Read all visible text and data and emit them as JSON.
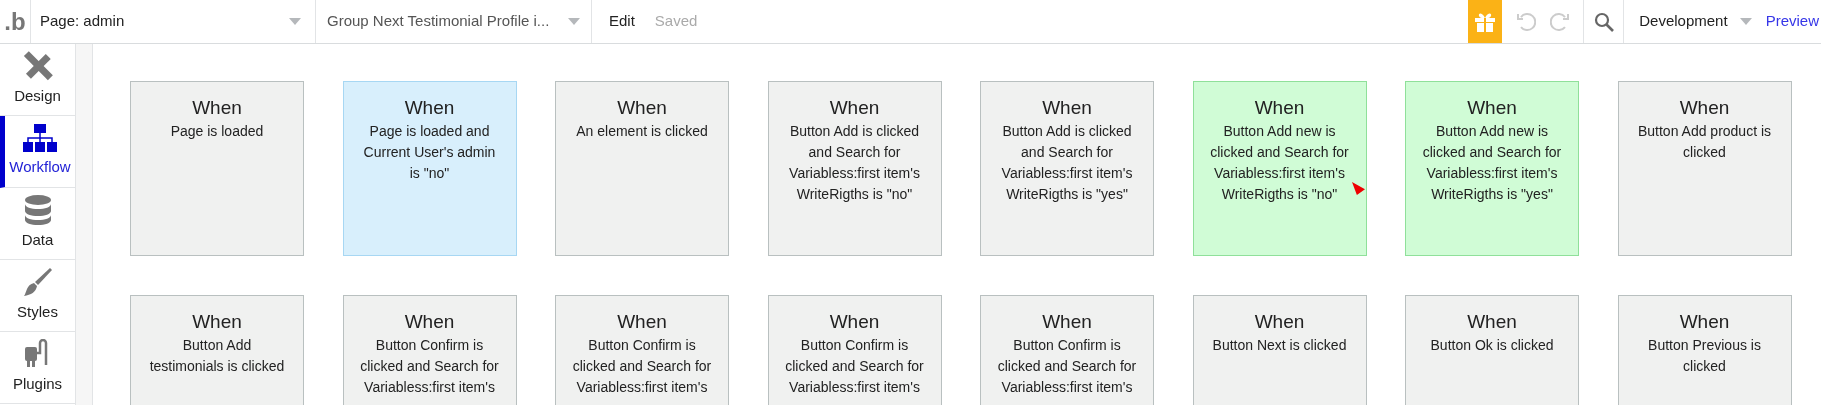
{
  "topbar": {
    "logo": ".b",
    "page_dropdown": "Page: admin",
    "element_dropdown": "Group Next Testimonial Profile i...",
    "edit": "Edit",
    "save_status": "Saved",
    "undo_disabled": true,
    "redo_disabled": true,
    "environment": "Development",
    "preview": "Preview"
  },
  "sidebar": {
    "items": [
      {
        "label": "Design",
        "kind": "design",
        "selected": false
      },
      {
        "label": "Workflow",
        "kind": "workflow",
        "selected": true
      },
      {
        "label": "Data",
        "kind": "data",
        "selected": false
      },
      {
        "label": "Styles",
        "kind": "styles",
        "selected": false
      },
      {
        "label": "Plugins",
        "kind": "plugins",
        "selected": false
      }
    ]
  },
  "events": [
    {
      "title": "When",
      "text": "Page is loaded",
      "color": "#f0f1f0",
      "flagged": false
    },
    {
      "title": "When",
      "text": "Page is loaded and Current User's admin is \"no\"",
      "color": "#d8effc",
      "flagged": false
    },
    {
      "title": "When",
      "text": "An element is clicked",
      "color": "#f0f1f0",
      "flagged": false
    },
    {
      "title": "When",
      "text": "Button Add is clicked and Search for Variabless:first item's WriteRigths is \"no\"",
      "color": "#f0f1f0",
      "flagged": false
    },
    {
      "title": "When",
      "text": "Button Add is clicked and Search for Variabless:first item's WriteRigths is \"yes\"",
      "color": "#f0f1f0",
      "flagged": false
    },
    {
      "title": "When",
      "text": "Button Add new is clicked and Search for Variabless:first item's WriteRigths is \"no\"",
      "color": "#d0fcd6",
      "flagged": true
    },
    {
      "title": "When",
      "text": "Button Add new is clicked and Search for Variabless:first item's WriteRigths is \"yes\"",
      "color": "#d0fcd6",
      "flagged": false
    },
    {
      "title": "When",
      "text": "Button Add product is clicked",
      "color": "#f0f1f0",
      "flagged": false
    },
    {
      "title": "When",
      "text": "Button Add testimonials is clicked",
      "color": "#f0f1f0",
      "flagged": false
    },
    {
      "title": "When",
      "text": "Button Confirm is clicked and Search for Variabless:first item's",
      "color": "#f0f1f0",
      "flagged": false
    },
    {
      "title": "When",
      "text": "Button Confirm is clicked and Search for Variabless:first item's",
      "color": "#f0f1f0",
      "flagged": false
    },
    {
      "title": "When",
      "text": "Button Confirm is clicked and Search for Variabless:first item's",
      "color": "#f0f1f0",
      "flagged": false
    },
    {
      "title": "When",
      "text": "Button Confirm is clicked and Search for Variabless:first item's",
      "color": "#f0f1f0",
      "flagged": false
    },
    {
      "title": "When",
      "text": "Button Next is clicked",
      "color": "#f0f1f0",
      "flagged": false
    },
    {
      "title": "When",
      "text": "Button Ok is clicked",
      "color": "#f0f1f0",
      "flagged": false
    },
    {
      "title": "When",
      "text": "Button Previous is clicked",
      "color": "#f0f1f0",
      "flagged": false
    }
  ]
}
